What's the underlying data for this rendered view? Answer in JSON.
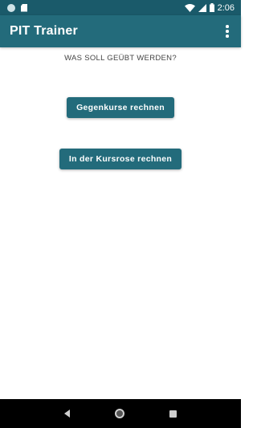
{
  "status_bar": {
    "time": "2:06",
    "icons": [
      "notification-dot-icon",
      "sd-card-icon",
      "wifi-icon",
      "signal-icon",
      "battery-icon"
    ]
  },
  "app_bar": {
    "title": "PIT Trainer",
    "menu_icon": "overflow-menu-icon"
  },
  "main": {
    "prompt": "WAS SOLL GEÜBT WERDEN?",
    "buttons": [
      {
        "label": "Gegenkurse rechnen"
      },
      {
        "label": "In der Kursrose rechnen"
      }
    ]
  },
  "nav_bar": {
    "icons": [
      "back-icon",
      "home-icon",
      "recent-apps-icon"
    ]
  },
  "colors": {
    "primary": "#236b7b",
    "primary_dark": "#1a5a6a",
    "background": "#ffffff"
  }
}
